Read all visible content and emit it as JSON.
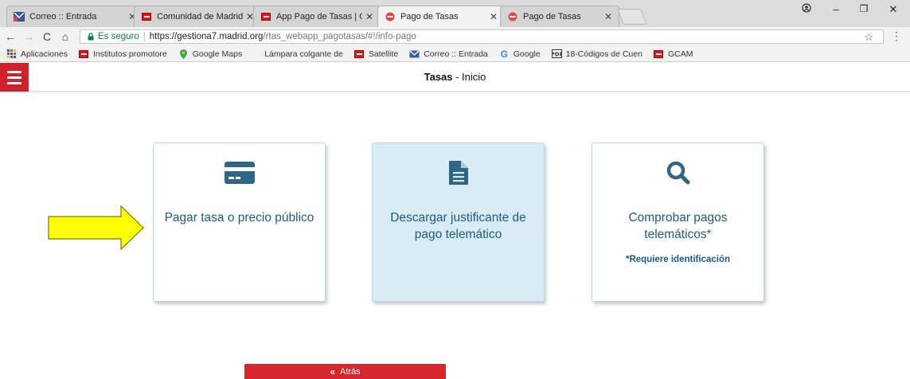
{
  "browser": {
    "tabs": [
      {
        "title": "Correo :: Entrada",
        "icon": "mail-icon",
        "active": false
      },
      {
        "title": "Comunidad de Madrid",
        "icon": "madrid-icon",
        "active": false
      },
      {
        "title": "App Pago de Tasas | Com",
        "icon": "madrid-icon",
        "active": false
      },
      {
        "title": "Pago de Tasas",
        "icon": "red-circle-icon",
        "active": true
      },
      {
        "title": "Pago de Tasas",
        "icon": "red-circle-icon",
        "active": false
      }
    ],
    "address": {
      "secure_label": "Es seguro",
      "url_host": "https://gestiona7.madrid.org",
      "url_path": "/rtas_webapp_pagotasas/#!/info-pago"
    },
    "bookmarks": [
      {
        "label": "Aplicaciones",
        "icon": "apps-grid-icon"
      },
      {
        "label": "Institutos promotore",
        "icon": "madrid-icon"
      },
      {
        "label": "Google Maps",
        "icon": "map-pin-icon"
      },
      {
        "label": "Lámpara colgante de",
        "icon": "blank-icon"
      },
      {
        "label": "Satellite",
        "icon": "madrid-icon"
      },
      {
        "label": "Correo :: Entrada",
        "icon": "mail-icon"
      },
      {
        "label": "Google",
        "icon": "google-icon"
      },
      {
        "label": "18-Códigos de Cuen",
        "icon": "pdf-icon"
      },
      {
        "label": "GCAM",
        "icon": "madrid-icon"
      }
    ]
  },
  "app": {
    "title_bold": "Tasas",
    "title_rest": " - Inicio",
    "accent_color": "#d0202a",
    "text_color": "#1d5b80"
  },
  "cards": [
    {
      "label": "Pagar tasa o precio público",
      "icon": "credit-card-icon",
      "note": ""
    },
    {
      "label": "Descargar justificante de pago telemático",
      "icon": "document-icon",
      "note": ""
    },
    {
      "label": "Comprobar pagos telemáticos*",
      "icon": "search-icon",
      "note": "*Requiere identificación"
    }
  ],
  "back_button": {
    "label": "Atrás"
  }
}
